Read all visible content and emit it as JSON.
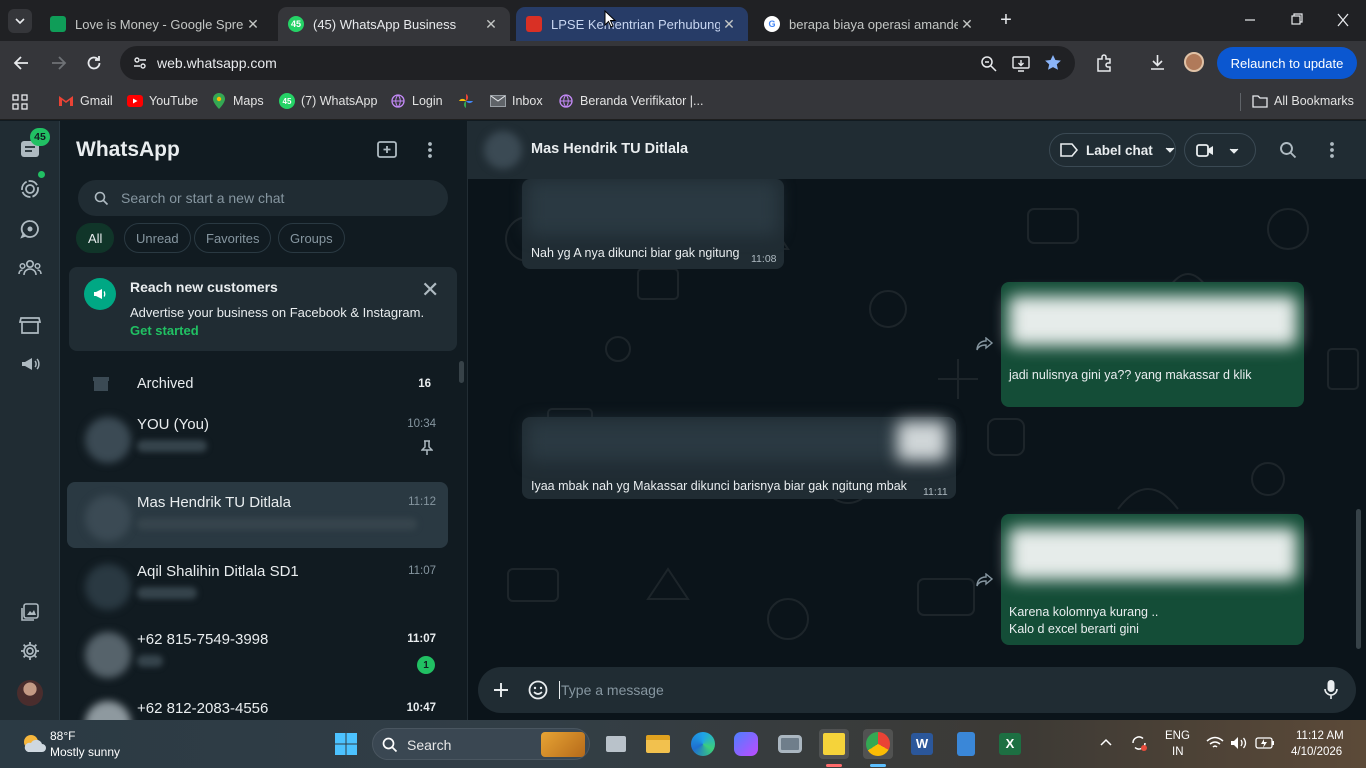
{
  "browser": {
    "tabs": [
      {
        "title": "Love is Money - Google Spread",
        "icon": "sheets-icon",
        "color": "#0f9d58"
      },
      {
        "title": "(45) WhatsApp Business",
        "icon": "whatsapp-icon",
        "badge": "45",
        "color": "#25d366"
      },
      {
        "title": "LPSE Kementrian Perhubungan",
        "icon": "pdf-icon",
        "color": "#d93025"
      },
      {
        "title": "berapa biaya operasi amandel",
        "icon": "google-icon",
        "color": "#4285f4"
      }
    ],
    "url": "web.whatsapp.com",
    "relaunch_label": "Relaunch to update",
    "bookmarks": [
      {
        "label": "Gmail",
        "icon": "gmail-icon"
      },
      {
        "label": "YouTube",
        "icon": "youtube-icon"
      },
      {
        "label": "Maps",
        "icon": "maps-icon"
      },
      {
        "label": "(7) WhatsApp",
        "icon": "whatsapp-icon",
        "badge": "45"
      },
      {
        "label": "Login",
        "icon": "globe-icon"
      },
      {
        "label": "",
        "icon": "pinwheel-icon"
      },
      {
        "label": "Inbox",
        "icon": "mail-icon"
      },
      {
        "label": "Beranda Verifikator |...",
        "icon": "globe-icon"
      }
    ],
    "all_bookmarks_label": "All Bookmarks"
  },
  "whatsapp": {
    "rail_badge": "45",
    "title": "WhatsApp",
    "search_placeholder": "Search or start a new chat",
    "filters": [
      "All",
      "Unread",
      "Favorites",
      "Groups"
    ],
    "promo": {
      "title": "Reach new customers",
      "text": "Advertise your business on Facebook & Instagram.",
      "link": "Get started"
    },
    "archived": {
      "label": "Archived",
      "count": "16"
    },
    "chats": [
      {
        "name": "YOU (You)",
        "time": "10:34",
        "pinned": true
      },
      {
        "name": "Mas Hendrik TU Ditlala",
        "time": "11:12",
        "selected": true
      },
      {
        "name": "Aqil Shalihin Ditlala SD1",
        "time": "11:07"
      },
      {
        "name": "+62 815-7549-3998",
        "time": "11:07",
        "unread": "1"
      },
      {
        "name": "+62 812-2083-4556",
        "time": "10:47"
      }
    ],
    "conversation": {
      "contact": "Mas Hendrik TU Ditlala",
      "label_chat": "Label chat",
      "messages": [
        {
          "dir": "in",
          "text": "Nah yg A nya dikunci biar gak ngitung",
          "time": "11:08"
        },
        {
          "dir": "out",
          "text": "jadi nulisnya gini ya?? yang makassar d klik",
          "forwarded": true
        },
        {
          "dir": "in",
          "text": "Iyaa mbak nah yg Makassar dikunci barisnya biar gak ngitung mbak",
          "time": "11:11"
        },
        {
          "dir": "out",
          "text": "Karena kolomnya kurang ..",
          "text2": "Kalo d excel berarti gini",
          "forwarded": true
        }
      ],
      "composer_placeholder": "Type a message"
    }
  },
  "taskbar": {
    "weather_temp": "88°F",
    "weather_desc": "Mostly sunny",
    "search_label": "Search",
    "lang": "ENG",
    "region": "IN",
    "time": "11:12 AM",
    "date": "4/10/2026"
  },
  "colors": {
    "wa_accent": "#00a884",
    "wa_green": "#21c063",
    "out_bubble": "#144d37",
    "in_bubble": "#202c33",
    "chrome_bg": "#202124",
    "relaunch": "#0b57d0"
  }
}
